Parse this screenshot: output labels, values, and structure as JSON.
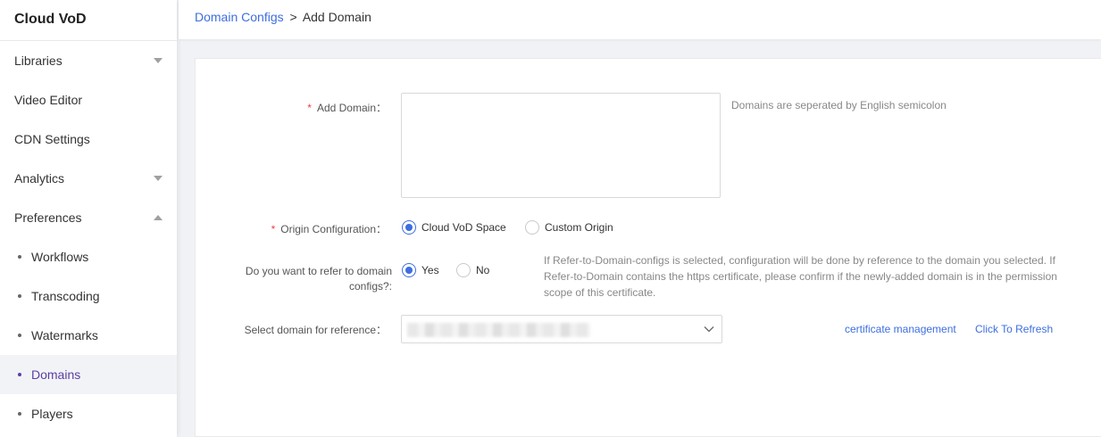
{
  "app": {
    "title": "Cloud VoD"
  },
  "sidebar": {
    "items": [
      {
        "label": "Libraries",
        "icon": "chevron-down-icon"
      },
      {
        "label": "Video Editor"
      },
      {
        "label": "CDN Settings"
      },
      {
        "label": "Analytics",
        "icon": "chevron-down-icon"
      },
      {
        "label": "Preferences",
        "icon": "chevron-up-icon"
      }
    ],
    "subitems": [
      {
        "label": "Workflows"
      },
      {
        "label": "Transcoding"
      },
      {
        "label": "Watermarks"
      },
      {
        "label": "Domains",
        "active": true
      },
      {
        "label": "Players"
      }
    ]
  },
  "breadcrumb": {
    "parent": "Domain Configs",
    "separator": ">",
    "current": "Add Domain"
  },
  "form": {
    "add_domain": {
      "label": "Add Domain：",
      "required_mark": "*",
      "value": "",
      "hint": "Domains are seperated by English semicolon"
    },
    "origin": {
      "label": "Origin Configuration：",
      "required_mark": "*",
      "options": [
        "Cloud VoD Space",
        "Custom Origin"
      ],
      "selected": "Cloud VoD Space"
    },
    "refer": {
      "label_line1": "Do you want to refer to domain",
      "label_line2": "configs?:",
      "options": [
        "Yes",
        "No"
      ],
      "selected": "Yes",
      "hint": [
        "If Refer-to-Domain-configs is selected, configuration will be done by reference to the domain you selected. If",
        "Refer-to-Domain contains the https certificate, please confirm if the newly-added domain is in the permission",
        "scope of this certificate."
      ]
    },
    "reference": {
      "label": "Select domain for reference：",
      "value_obscured": true,
      "icon": "chevron-down-icon",
      "cert_link": "certificate management",
      "refresh_link": "Click To Refresh"
    }
  },
  "colors": {
    "accent": "#3d6ee0",
    "active_nav": "#5b3fa0",
    "required": "#e54545"
  }
}
